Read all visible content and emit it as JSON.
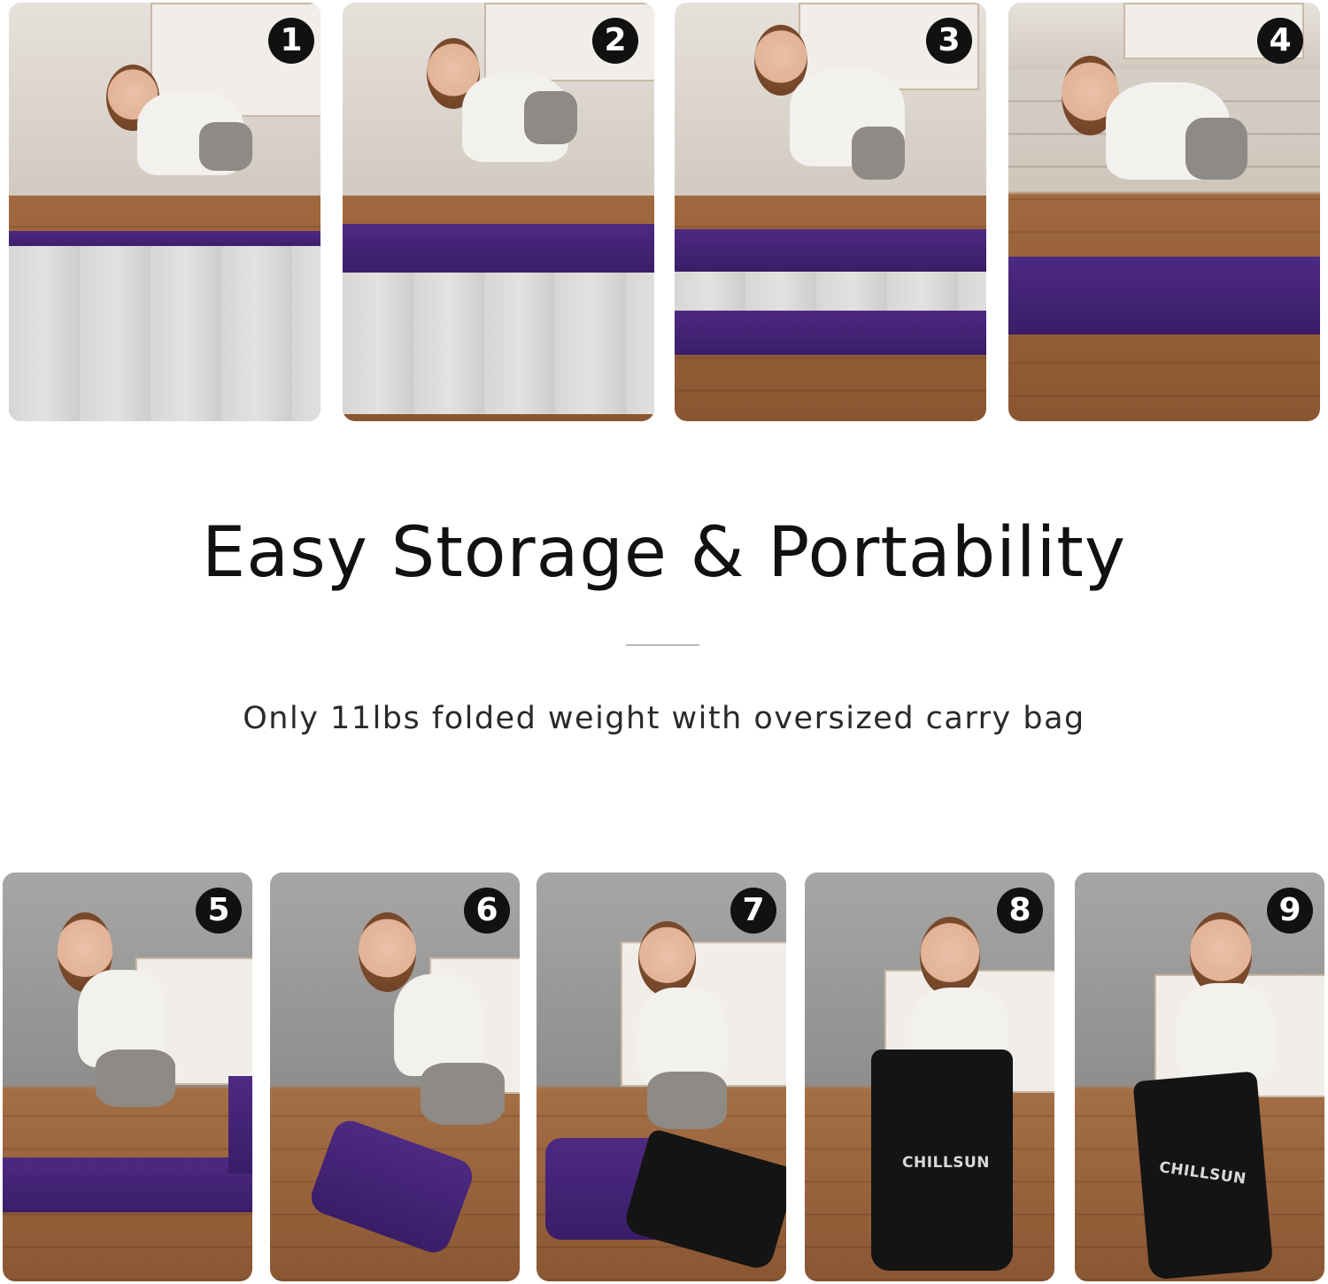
{
  "headline": "Easy Storage & Portability",
  "subline": "Only 11lbs folded weight with oversized carry bag",
  "steps": [
    {
      "number": "1"
    },
    {
      "number": "2"
    },
    {
      "number": "3"
    },
    {
      "number": "4"
    },
    {
      "number": "5"
    },
    {
      "number": "6"
    },
    {
      "number": "7"
    },
    {
      "number": "8"
    },
    {
      "number": "9"
    }
  ],
  "bag_logo": "CHILLSUN",
  "colors": {
    "badge": "#111111",
    "mattress_purple": "#4d2a82",
    "mattress_gray": "#d8d6d4",
    "bag": "#141414"
  }
}
